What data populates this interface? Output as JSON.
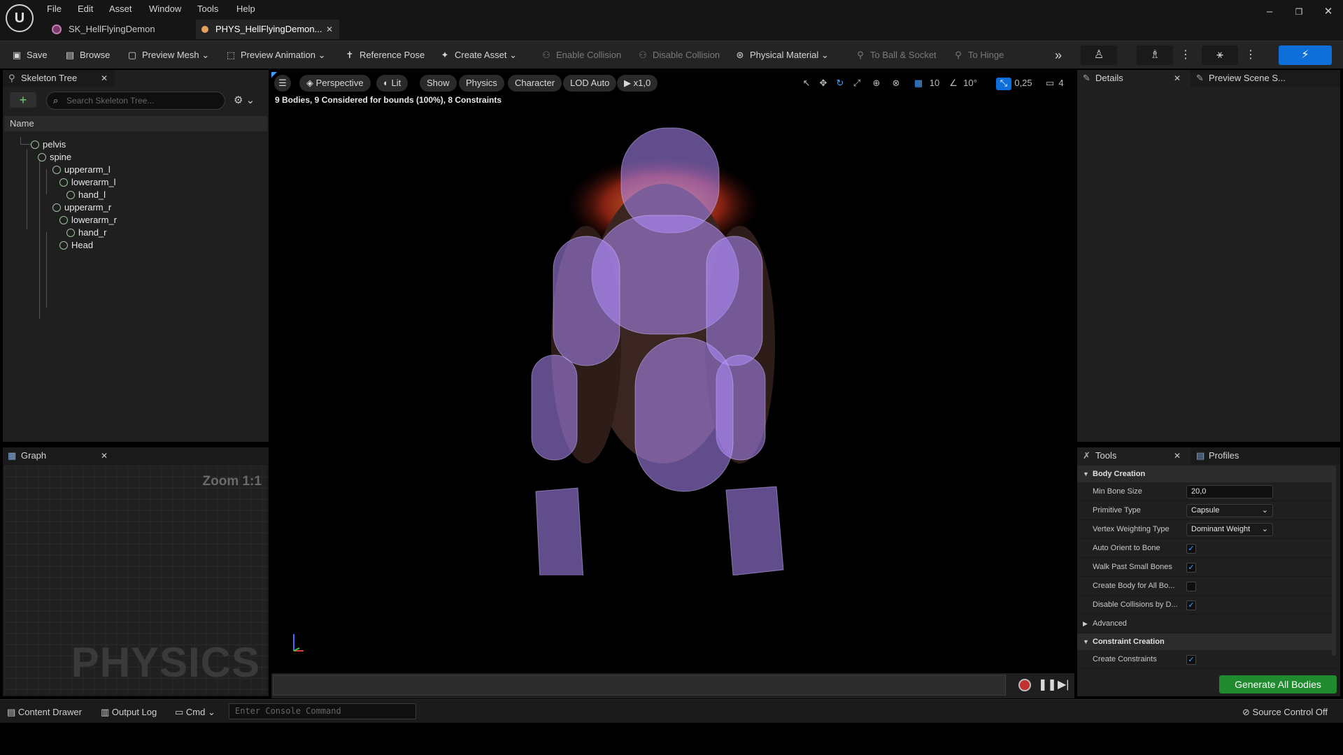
{
  "menu": [
    "File",
    "Edit",
    "Asset",
    "Window",
    "Tools",
    "Help"
  ],
  "doc_tabs": [
    {
      "label": "SK_HellFlyingDemon"
    },
    {
      "label": "PHYS_HellFlyingDemon..."
    }
  ],
  "window_controls": {
    "minimize": "–",
    "restore": "❐",
    "close": "✕"
  },
  "toolbar": {
    "save": "Save",
    "browse": "Browse",
    "preview_mesh": "Preview Mesh",
    "preview_animation": "Preview Animation",
    "reference_pose": "Reference Pose",
    "create_asset": "Create Asset",
    "enable_collision": "Enable Collision",
    "disable_collision": "Disable Collision",
    "physical_material": "Physical Material",
    "to_ball_socket": "To Ball & Socket",
    "to_hinge": "To Hinge"
  },
  "skeleton_tree": {
    "tab_label": "Skeleton Tree",
    "search_placeholder": "Search Skeleton Tree...",
    "column_header": "Name",
    "bones": [
      {
        "name": "pelvis",
        "depth": 0
      },
      {
        "name": "spine",
        "depth": 1
      },
      {
        "name": "upperarm_l",
        "depth": 2
      },
      {
        "name": "lowerarm_l",
        "depth": 3
      },
      {
        "name": "hand_l",
        "depth": 4
      },
      {
        "name": "upperarm_r",
        "depth": 2
      },
      {
        "name": "lowerarm_r",
        "depth": 3
      },
      {
        "name": "hand_r",
        "depth": 4
      },
      {
        "name": "Head",
        "depth": 3
      }
    ]
  },
  "graph": {
    "tab_label": "Graph",
    "zoom": "Zoom 1:1",
    "watermark": "PHYSICS"
  },
  "viewport": {
    "perspective": "Perspective",
    "lit": "Lit",
    "show": "Show",
    "physics": "Physics",
    "character": "Character",
    "lod": "LOD Auto",
    "play_rate": "x1,0",
    "grid_snap": "10",
    "rotation_snap": "10°",
    "scale_snap": "0,25",
    "camera_speed": "4",
    "stats": "9 Bodies, 9 Considered for bounds (100%), 8 Constraints"
  },
  "details": {
    "tab_label": "Details",
    "preview_tab_label": "Preview Scene S..."
  },
  "tools": {
    "tab_label": "Tools",
    "profiles_label": "Profiles",
    "body_creation": "Body Creation",
    "min_bone_size_label": "Min Bone Size",
    "min_bone_size": "20,0",
    "primitive_type_label": "Primitive Type",
    "primitive_type": "Capsule",
    "vertex_weighting_label": "Vertex Weighting Type",
    "vertex_weighting": "Dominant Weight",
    "auto_orient_label": "Auto Orient to Bone",
    "auto_orient": true,
    "walk_past_label": "Walk Past Small Bones",
    "walk_past": true,
    "create_body_all_label": "Create Body for All Bo...",
    "create_body_all": false,
    "disable_collisions_label": "Disable Collisions by D...",
    "disable_collisions": true,
    "advanced": "Advanced",
    "constraint_creation": "Constraint Creation",
    "create_constraints_label": "Create Constraints",
    "create_constraints": true,
    "generate_button": "Generate All Bodies"
  },
  "statusbar": {
    "content_drawer": "Content Drawer",
    "output_log": "Output Log",
    "cmd": "Cmd",
    "console_placeholder": "Enter Console Command",
    "source_control": "Source Control Off"
  },
  "colors": {
    "accent_blue": "#0e6fd8",
    "generate_green": "#1f8a2e",
    "check_blue": "#4aa3ff"
  }
}
